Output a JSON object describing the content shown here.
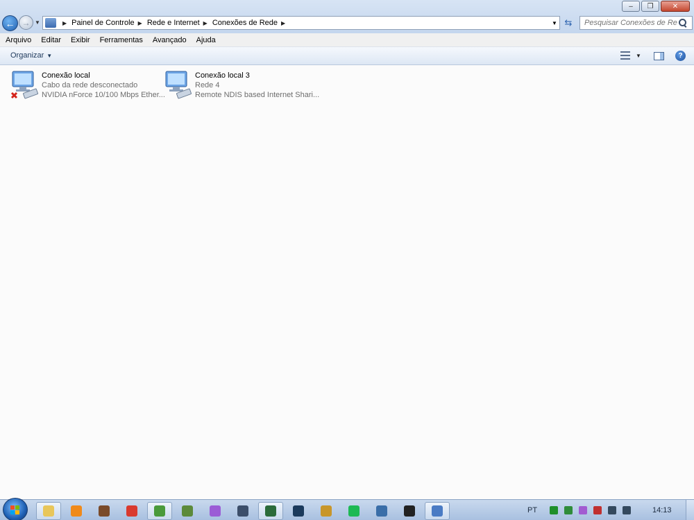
{
  "window": {
    "minimize_glyph": "–",
    "restore_glyph": "❐",
    "close_glyph": "✕"
  },
  "address": {
    "crumbs": [
      {
        "label": "Painel de Controle"
      },
      {
        "label": "Rede e Internet"
      },
      {
        "label": "Conexões de Rede"
      }
    ]
  },
  "search": {
    "placeholder": "Pesquisar Conexões de Rede"
  },
  "menu": {
    "items": [
      "Arquivo",
      "Editar",
      "Exibir",
      "Ferramentas",
      "Avançado",
      "Ajuda"
    ]
  },
  "command": {
    "organize_label": "Organizar",
    "help_glyph": "?"
  },
  "connections": [
    {
      "name": "Conexão local",
      "status": "Cabo da rede desconectado",
      "device": "NVIDIA nForce 10/100 Mbps Ether...",
      "disconnected": true,
      "icon": "network-adapter-icon"
    },
    {
      "name": "Conexão local 3",
      "status": "Rede  4",
      "device": "Remote NDIS based Internet Shari...",
      "disconnected": false,
      "icon": "network-adapter-icon"
    }
  ],
  "taskbar": {
    "items": [
      {
        "name": "explorer-icon",
        "color": "#e8c65a",
        "active": true
      },
      {
        "name": "media-player-icon",
        "color": "#f08a1a",
        "active": false
      },
      {
        "name": "app-icon",
        "color": "#7a4b2a",
        "active": false
      },
      {
        "name": "record-icon",
        "color": "#d93a2f",
        "active": false
      },
      {
        "name": "chrome-icon",
        "color": "#4a9a3b",
        "active": true
      },
      {
        "name": "minecraft-icon",
        "color": "#5c8a3a",
        "active": false
      },
      {
        "name": "pen-icon",
        "color": "#9b5cd6",
        "active": false
      },
      {
        "name": "audio-icon",
        "color": "#3c4e6a",
        "active": false
      },
      {
        "name": "terminal-icon",
        "color": "#2b6b3a",
        "active": true
      },
      {
        "name": "steam-icon",
        "color": "#1b3a5c",
        "active": false
      },
      {
        "name": "game-icon",
        "color": "#c8962a",
        "active": false
      },
      {
        "name": "spotify-icon",
        "color": "#1db954",
        "active": false
      },
      {
        "name": "download-icon",
        "color": "#3a6ea8",
        "active": false
      },
      {
        "name": "dark-app-icon",
        "color": "#222222",
        "active": false
      },
      {
        "name": "network-icon",
        "color": "#4a7bc4",
        "active": true
      }
    ],
    "language": "PT",
    "tray_icons": [
      {
        "name": "tray-green-icon",
        "color": "#1f8f2a"
      },
      {
        "name": "tray-shield-icon",
        "color": "#2f8c3a"
      },
      {
        "name": "tray-pen-icon",
        "color": "#a25bd1"
      },
      {
        "name": "tray-flag-icon",
        "color": "#c03030"
      },
      {
        "name": "tray-network-icon",
        "color": "#34495e"
      },
      {
        "name": "tray-volume-icon",
        "color": "#34495e"
      }
    ],
    "clock": "14:13"
  }
}
